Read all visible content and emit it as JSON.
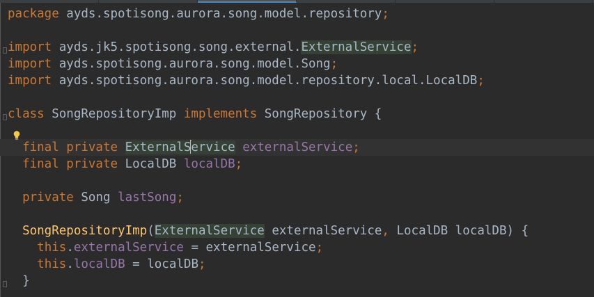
{
  "editor": {
    "lines": [
      {
        "tokens": [
          {
            "t": "package",
            "c": "kw"
          },
          {
            "t": " ayds.spotisong.aurora.song.model.repository",
            "c": "plain"
          },
          {
            "t": ";",
            "c": "kw"
          }
        ]
      },
      {
        "tokens": []
      },
      {
        "tokens": [
          {
            "t": "import",
            "c": "kw"
          },
          {
            "t": " ayds.jk5.spotisong.song.external.",
            "c": "plain"
          },
          {
            "t": "ExternalService",
            "c": "plain hl"
          },
          {
            "t": ";",
            "c": "kw"
          }
        ]
      },
      {
        "tokens": [
          {
            "t": "import",
            "c": "kw"
          },
          {
            "t": " ayds.spotisong.aurora.song.model.Song",
            "c": "plain"
          },
          {
            "t": ";",
            "c": "kw"
          }
        ]
      },
      {
        "tokens": [
          {
            "t": "import",
            "c": "kw"
          },
          {
            "t": " ayds.spotisong.aurora.song.model.repository.local.LocalDB",
            "c": "plain"
          },
          {
            "t": ";",
            "c": "kw"
          }
        ]
      },
      {
        "tokens": []
      },
      {
        "tokens": [
          {
            "t": "class",
            "c": "kw"
          },
          {
            "t": " SongRepositoryImp ",
            "c": "plain"
          },
          {
            "t": "implements",
            "c": "kw"
          },
          {
            "t": " SongRepository {",
            "c": "plain"
          }
        ]
      },
      {
        "tokens": []
      },
      {
        "tokens": [
          {
            "t": "  ",
            "c": "plain"
          },
          {
            "t": "final private",
            "c": "kw"
          },
          {
            "t": " ",
            "c": "plain"
          },
          {
            "t": "ExternalS",
            "c": "plain hl"
          },
          {
            "t": "",
            "c": "caret"
          },
          {
            "t": "ervice",
            "c": "plain hl"
          },
          {
            "t": " ",
            "c": "plain"
          },
          {
            "t": "externalService",
            "c": "fld"
          },
          {
            "t": ";",
            "c": "kw"
          }
        ]
      },
      {
        "tokens": [
          {
            "t": "  ",
            "c": "plain"
          },
          {
            "t": "final private",
            "c": "kw"
          },
          {
            "t": " LocalDB ",
            "c": "plain"
          },
          {
            "t": "localDB",
            "c": "fld"
          },
          {
            "t": ";",
            "c": "kw"
          }
        ]
      },
      {
        "tokens": []
      },
      {
        "tokens": [
          {
            "t": "  ",
            "c": "plain"
          },
          {
            "t": "private",
            "c": "kw"
          },
          {
            "t": " Song ",
            "c": "plain"
          },
          {
            "t": "lastSong",
            "c": "fld"
          },
          {
            "t": ";",
            "c": "kw"
          }
        ]
      },
      {
        "tokens": []
      },
      {
        "tokens": [
          {
            "t": "  ",
            "c": "plain"
          },
          {
            "t": "SongRepositoryImp",
            "c": "fn"
          },
          {
            "t": "(",
            "c": "plain"
          },
          {
            "t": "ExternalService",
            "c": "plain hl"
          },
          {
            "t": " externalService",
            "c": "plain"
          },
          {
            "t": ",",
            "c": "kw"
          },
          {
            "t": " LocalDB localDB) {",
            "c": "plain"
          }
        ]
      },
      {
        "tokens": [
          {
            "t": "    ",
            "c": "plain"
          },
          {
            "t": "this",
            "c": "kw"
          },
          {
            "t": ".",
            "c": "plain"
          },
          {
            "t": "externalService",
            "c": "fld"
          },
          {
            "t": " = externalService",
            "c": "plain"
          },
          {
            "t": ";",
            "c": "kw"
          }
        ]
      },
      {
        "tokens": [
          {
            "t": "    ",
            "c": "plain"
          },
          {
            "t": "this",
            "c": "kw"
          },
          {
            "t": ".",
            "c": "plain"
          },
          {
            "t": "localDB",
            "c": "fld"
          },
          {
            "t": " = localDB",
            "c": "plain"
          },
          {
            "t": ";",
            "c": "kw"
          }
        ]
      },
      {
        "tokens": [
          {
            "t": "  }",
            "c": "plain"
          }
        ]
      }
    ]
  },
  "icons": {
    "intention": "lightbulb-icon",
    "fold": "fold-marker-icon"
  },
  "colors": {
    "background": "#2b2b2b",
    "keyword": "#cc7832",
    "field": "#9876aa",
    "method": "#ffc66d",
    "text": "#a9b7c6",
    "usage_highlight": "#344134",
    "caret_row": "#323232",
    "intention_bulb": "#f2c94c"
  }
}
